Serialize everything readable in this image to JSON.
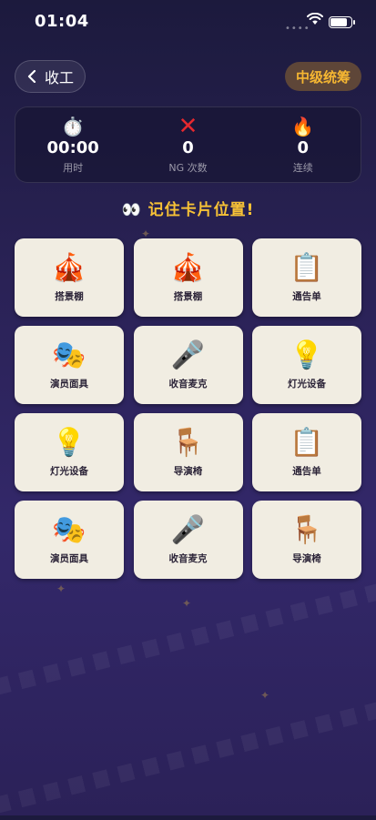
{
  "status_bar": {
    "time": "01:04"
  },
  "nav": {
    "back_label": "收工",
    "level_badge": "中级统筹"
  },
  "stats": [
    {
      "icon": "⏱️",
      "icon_name": "stopwatch-icon",
      "value": "00:00",
      "label": "用时"
    },
    {
      "icon": "✕",
      "icon_name": "cross-mark-icon",
      "value": "0",
      "label": "NG 次数"
    },
    {
      "icon": "🔥",
      "icon_name": "fire-icon",
      "value": "0",
      "label": "连续"
    }
  ],
  "instruction": "👀 记住卡片位置!",
  "cards": [
    {
      "icon": "🎪",
      "label": "搭景棚"
    },
    {
      "icon": "🎪",
      "label": "搭景棚"
    },
    {
      "icon": "📋",
      "label": "通告单"
    },
    {
      "icon": "🎭",
      "label": "演员面具"
    },
    {
      "icon": "🎤",
      "label": "收音麦克"
    },
    {
      "icon": "💡",
      "label": "灯光设备"
    },
    {
      "icon": "💡",
      "label": "灯光设备"
    },
    {
      "icon": "🪑",
      "label": "导演椅"
    },
    {
      "icon": "📋",
      "label": "通告单"
    },
    {
      "icon": "🎭",
      "label": "演员面具"
    },
    {
      "icon": "🎤",
      "label": "收音麦克"
    },
    {
      "icon": "🪑",
      "label": "导演椅"
    }
  ],
  "colors": {
    "accent": "#f7c236",
    "badge_bg": "#5e4638",
    "card_bg": "#f1ede2",
    "ng_red": "#e5292f"
  }
}
